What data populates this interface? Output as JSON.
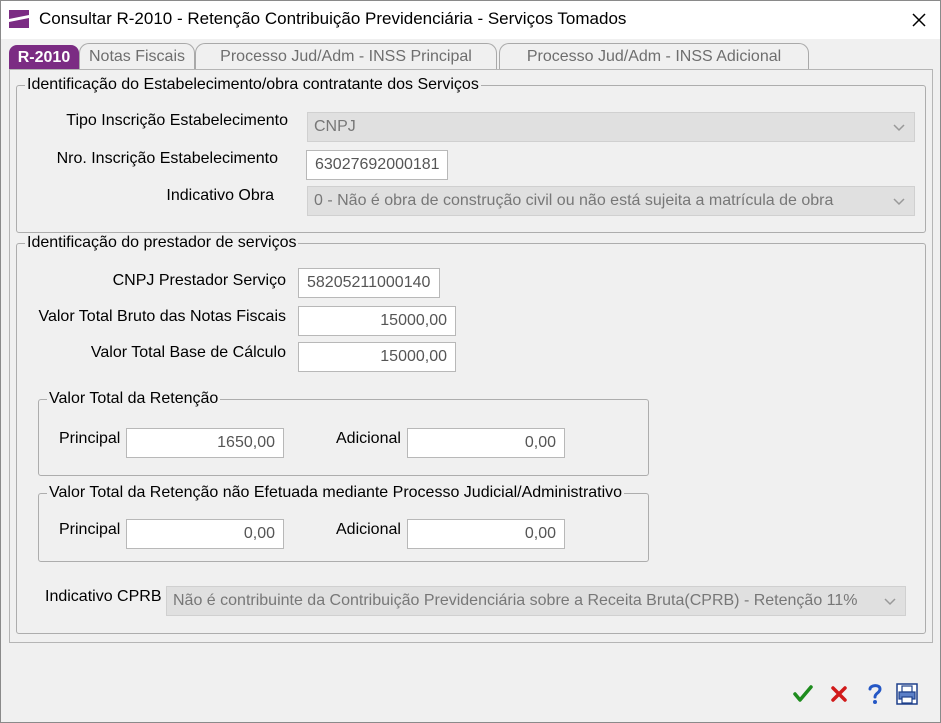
{
  "window": {
    "title": "Consultar R-2010 - Retenção Contribuição Previdenciária - Serviços Tomados",
    "accent_color": "#7b2c83"
  },
  "tabs": [
    {
      "label": "R-2010",
      "active": true
    },
    {
      "label": "Notas Fiscais",
      "active": false
    },
    {
      "label": "Processo Jud/Adm - INSS Principal",
      "active": false
    },
    {
      "label": "Processo Jud/Adm - INSS Adicional",
      "active": false
    }
  ],
  "estabelecimento": {
    "legend": "Identificação do Estabelecimento/obra contratante dos Serviços",
    "tipo_label": "Tipo Inscrição Estabelecimento",
    "tipo_value": "CNPJ",
    "nro_label": "Nro. Inscrição Estabelecimento",
    "nro_value": "63027692000181",
    "obra_label": "Indicativo Obra",
    "obra_value": "0 - Não é obra de construção civil ou não está sujeita a matrícula de obra"
  },
  "prestador": {
    "legend": "Identificação do prestador de serviços",
    "cnpj_label": "CNPJ Prestador Serviço",
    "cnpj_value": "58205211000140",
    "bruto_label": "Valor Total Bruto das Notas Fiscais",
    "bruto_value": "15000,00",
    "base_label": "Valor Total Base de Cálculo",
    "base_value": "15000,00",
    "retencao": {
      "legend": "Valor Total da Retenção",
      "principal_label": "Principal",
      "principal_value": "1650,00",
      "adicional_label": "Adicional",
      "adicional_value": "0,00"
    },
    "nao_efetuada": {
      "legend": "Valor Total da Retenção não Efetuada mediante Processo Judicial/Administrativo",
      "principal_label": "Principal",
      "principal_value": "0,00",
      "adicional_label": "Adicional",
      "adicional_value": "0,00"
    },
    "cprb_label": "Indicativo CPRB",
    "cprb_value": "Não é contribuinte da Contribuição Previdenciária sobre a Receita Bruta(CPRB) - Retenção 11%"
  },
  "buttons": {
    "confirm_icon": "checkmark-icon",
    "cancel_icon": "x-icon",
    "help_icon": "question-icon",
    "print_icon": "printer-icon"
  }
}
